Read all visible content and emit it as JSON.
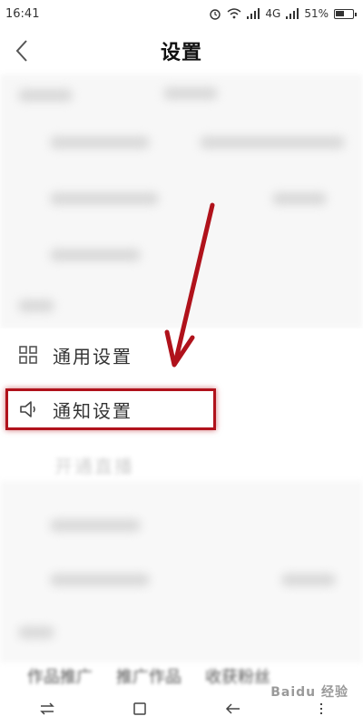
{
  "status_bar": {
    "time": "16:41",
    "network": "4G",
    "battery_text": "51%",
    "battery_level": 0.51
  },
  "header": {
    "title": "设置",
    "back_icon": "chevron-left-icon"
  },
  "settings_items": [
    {
      "label": "通用设置",
      "icon": "grid-icon"
    },
    {
      "label": "通知设置",
      "icon": "speaker-icon"
    }
  ],
  "faded_item": {
    "label": "开通直播"
  },
  "bottom_tabs": [
    "作品推广",
    "推广作品",
    "收获粉丝"
  ],
  "watermark": "Baidu 经验",
  "annotation": {
    "highlight_color": "#b0121b"
  }
}
